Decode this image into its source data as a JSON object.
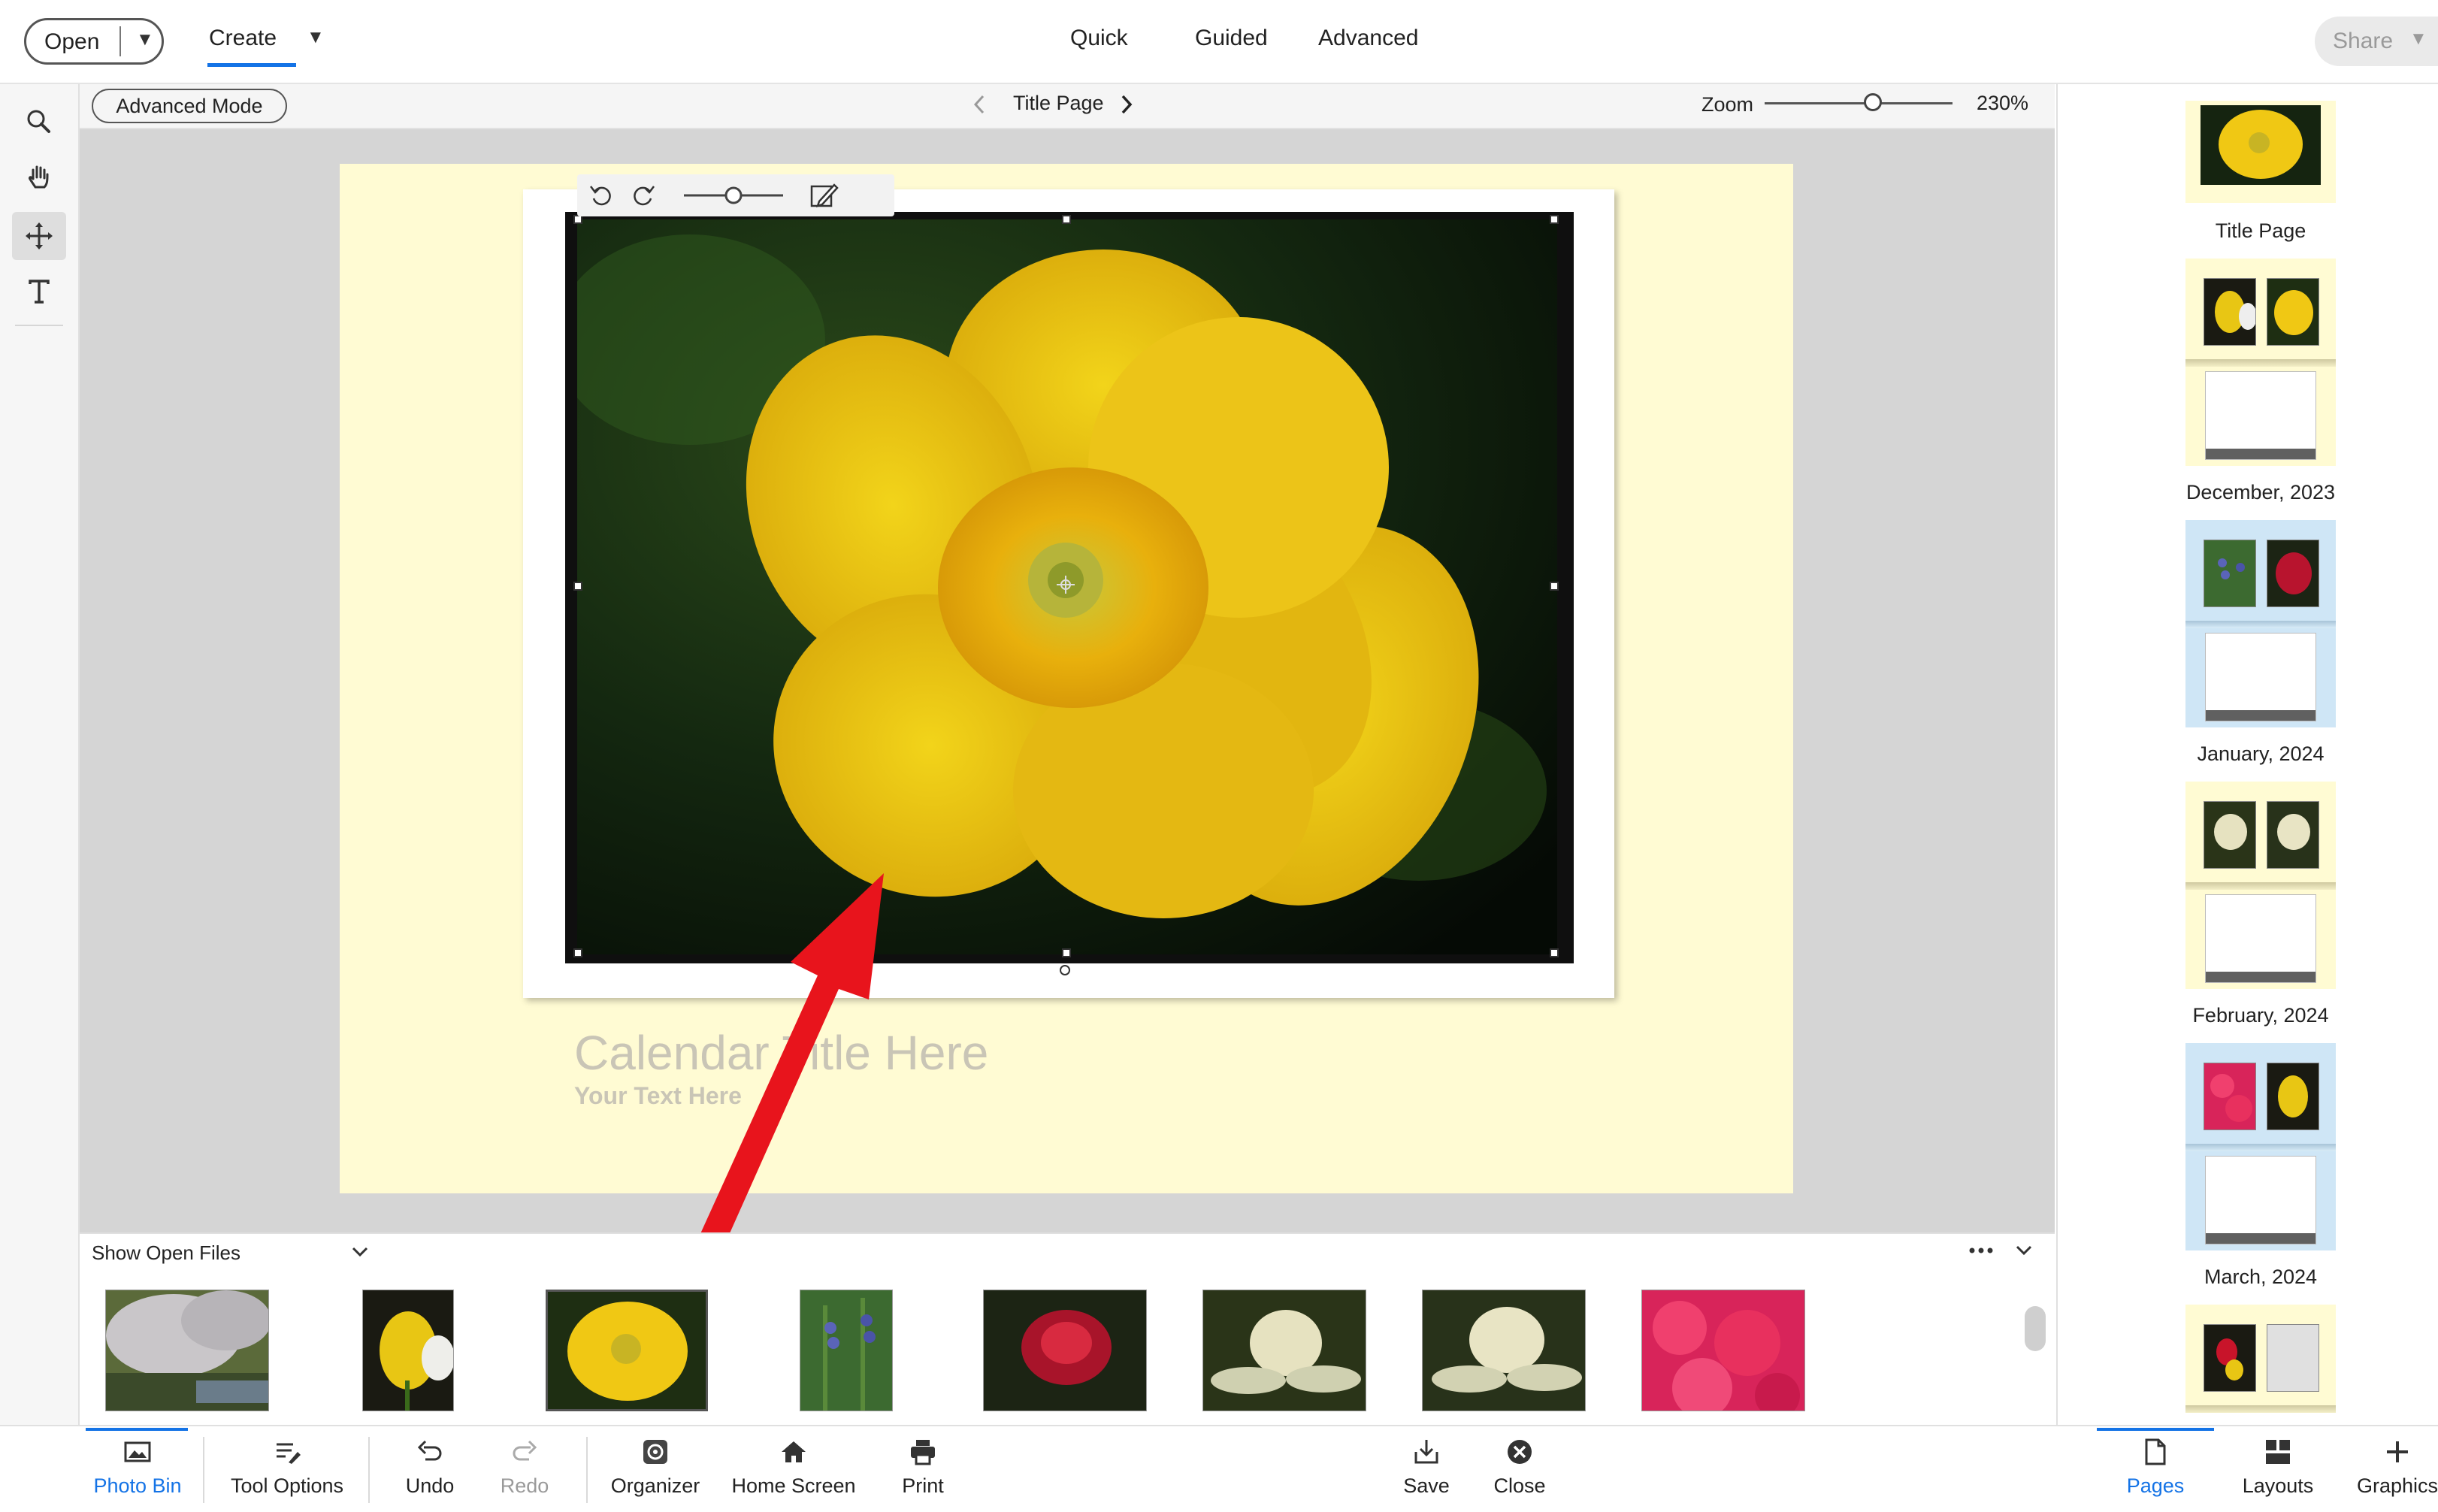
{
  "header": {
    "open_label": "Open",
    "create_label": "Create",
    "modes": [
      "Quick",
      "Guided",
      "Advanced"
    ],
    "share_label": "Share"
  },
  "options_bar": {
    "advanced_mode_label": "Advanced Mode",
    "page_name": "Title Page",
    "zoom_label": "Zoom",
    "zoom_value": "230%",
    "zoom_slider_fraction": 0.55
  },
  "tools": [
    "zoom-icon",
    "hand-icon",
    "move-icon",
    "type-icon"
  ],
  "canvas": {
    "title_placeholder": "Calendar Title Here",
    "subtitle_placeholder": "Your Text Here",
    "page_color": "#fffbd3"
  },
  "photo_bin": {
    "dropdown_label": "Show Open Files",
    "photos": [
      "wisteria-garden",
      "yellow-tulip",
      "yellow-buttercup",
      "bluebells",
      "red-waratah",
      "white-waratah-1",
      "white-waratah-2",
      "pink-azaleas"
    ],
    "selected_index": 2
  },
  "bottom_bar": {
    "left": [
      {
        "label": "Photo Bin",
        "icon": "photo-bin-icon",
        "active": true
      },
      {
        "label": "Tool Options",
        "icon": "tool-options-icon"
      },
      {
        "label": "Undo",
        "icon": "undo-icon"
      },
      {
        "label": "Redo",
        "icon": "redo-icon",
        "disabled": true
      },
      {
        "label": "Organizer",
        "icon": "organizer-icon"
      },
      {
        "label": "Home Screen",
        "icon": "home-icon"
      },
      {
        "label": "Print",
        "icon": "print-icon"
      }
    ],
    "center": [
      {
        "label": "Save",
        "icon": "save-icon"
      },
      {
        "label": "Close",
        "icon": "close-icon"
      }
    ],
    "right": [
      {
        "label": "Pages",
        "icon": "pages-icon",
        "active": true
      },
      {
        "label": "Layouts",
        "icon": "layouts-icon"
      },
      {
        "label": "Graphics",
        "icon": "graphics-icon"
      }
    ]
  },
  "pages_panel": {
    "pages": [
      "Title Page",
      "December, 2023",
      "January, 2024",
      "February, 2024",
      "March, 2024"
    ]
  },
  "colors": {
    "accent": "#1473e6",
    "annotation_arrow": "#e8141c"
  }
}
